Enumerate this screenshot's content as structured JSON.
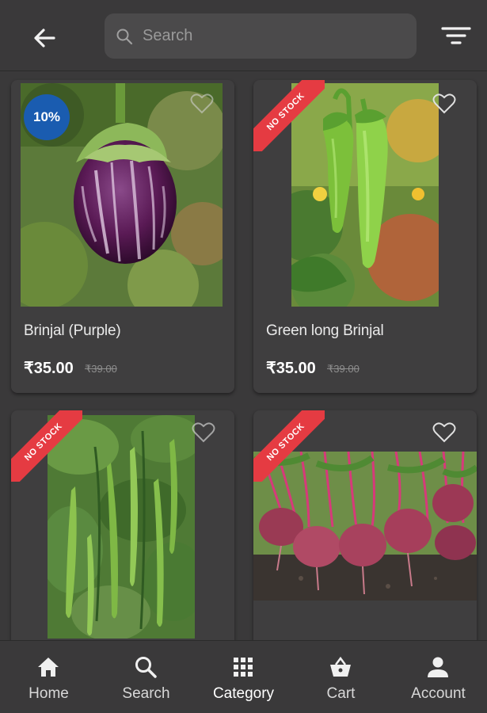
{
  "header": {
    "search_placeholder": "Search",
    "back_icon": "arrow-left-icon",
    "filter_icon": "filter-icon"
  },
  "products": [
    {
      "name": "Brinjal (Purple)",
      "price": "₹35.00",
      "old_price": "₹39.00",
      "badge": "10%",
      "ribbon": ""
    },
    {
      "name": "Green long Brinjal",
      "price": "₹35.00",
      "old_price": "₹39.00",
      "badge": "",
      "ribbon": "NO STOCK"
    },
    {
      "name": "",
      "price": "",
      "old_price": "",
      "badge": "",
      "ribbon": "NO STOCK"
    },
    {
      "name": "",
      "price": "",
      "old_price": "",
      "badge": "",
      "ribbon": "NO STOCK"
    }
  ],
  "nav": {
    "items": [
      {
        "label": "Home",
        "icon": "home-icon"
      },
      {
        "label": "Search",
        "icon": "search-icon"
      },
      {
        "label": "Category",
        "icon": "grid-icon"
      },
      {
        "label": "Cart",
        "icon": "basket-icon"
      },
      {
        "label": "Account",
        "icon": "person-icon"
      }
    ],
    "active": "Category"
  },
  "colors": {
    "background": "#3a393a",
    "card": "#3f3e3f",
    "ribbon": "#e53b42",
    "discount_badge": "#1a5cb0"
  }
}
